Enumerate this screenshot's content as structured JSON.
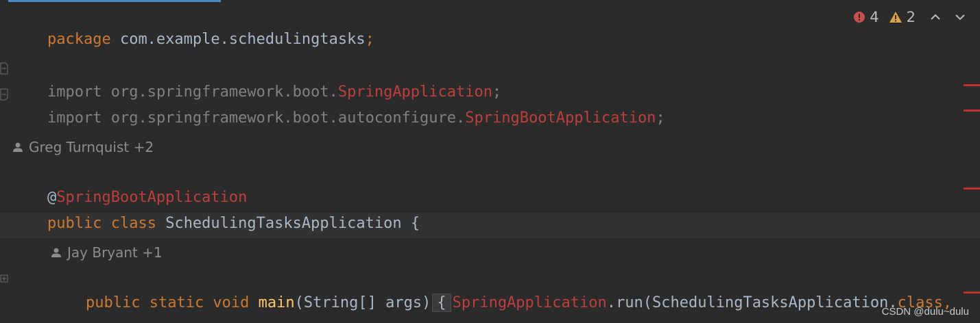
{
  "editor": {
    "lines": {
      "package": {
        "keyword": "package",
        "name": " com.example.schedulingtasks",
        "semicolon": ";"
      },
      "import1": {
        "keyword": "import",
        "path": " org.springframework.boot.",
        "cls": "SpringApplication",
        "semicolon": ";"
      },
      "import2": {
        "keyword": "import",
        "path": " org.springframework.boot.autoconfigure.",
        "cls": "SpringBootApplication",
        "semicolon": ";"
      },
      "annotation": {
        "at": "@",
        "name": "SpringBootApplication"
      },
      "class_decl": {
        "kw1": "public",
        "kw2": " class",
        "name": " SchedulingTasksApplication ",
        "brace": "{"
      },
      "main_decl": {
        "kw1": "public",
        "kw2": " static",
        "kw3": " void",
        "fn": " main",
        "params": "(String[] args)",
        "brace": "{",
        "call_cls": "SpringApplication",
        "call_rest": ".run(SchedulingTasksApplication.",
        "class_kw": "class",
        "trailing": ","
      }
    },
    "author_hints": {
      "class_authors": "Greg Turnquist +2",
      "method_authors": "Jay Bryant +1"
    }
  },
  "inspections": {
    "errors": "4",
    "warnings": "2",
    "error_color": "#c94f4f",
    "warning_color": "#d9a343"
  },
  "watermark": "CSDN @dulu~dulu"
}
